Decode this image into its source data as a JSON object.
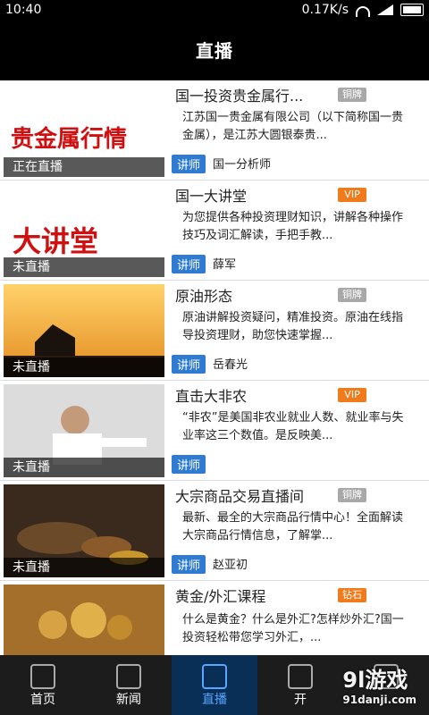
{
  "status": {
    "time": "10:40",
    "speed": "0.17K/s"
  },
  "header": {
    "title": "直播"
  },
  "items": [
    {
      "title": "国一投资贵金属行...",
      "tag": "铜牌",
      "tag_color": "#a8a8a8",
      "desc": "江苏国一贵金属有限公司（以下简称国一贵金属），是江苏大圆银泰贵...",
      "badge": "讲师",
      "lecturer": "国一分析师",
      "live": "正在直播",
      "thumb_color": "#ffffff"
    },
    {
      "title": "国一大讲堂",
      "tag": "VIP",
      "tag_color": "#f07b1d",
      "desc": "为您提供各种投资理财知识，讲解各种操作技巧及词汇解读，手把手教...",
      "badge": "讲师",
      "lecturer": "薛军",
      "live": "未直播",
      "thumb_color": "#ffffff"
    },
    {
      "title": "原油形态",
      "tag": "铜牌",
      "tag_color": "#a8a8a8",
      "desc": "原油讲解投资疑问，精准投资。原油在线指导投资理财，助您快速掌握...",
      "badge": "讲师",
      "lecturer": "岳春光",
      "live": "未直播",
      "thumb_color": "#e39a2b"
    },
    {
      "title": "直击大非农",
      "tag": "VIP",
      "tag_color": "#f07b1d",
      "desc": "“非农”是美国非农业就业人数、就业率与失业率这三个数值。是反映美...",
      "badge": "讲师",
      "lecturer": "",
      "live": "未直播",
      "thumb_color": "#dcdcdc"
    },
    {
      "title": "大宗商品交易直播间",
      "tag": "铜牌",
      "tag_color": "#a8a8a8",
      "desc": "最新、最全的大宗商品行情中心！全面解读大宗商品行情信息，了解掌...",
      "badge": "讲师",
      "lecturer": "赵亚初",
      "live": "未直播",
      "thumb_color": "#3a2a1d"
    },
    {
      "title": "黄金/外汇课程",
      "tag": "钻石",
      "tag_color": "#f07b1d",
      "desc": "什么是黄金？什么是外汇?怎样炒外汇?国一投资轻松带您学习外汇，...",
      "badge": "",
      "lecturer": "",
      "live": "",
      "thumb_color": "#a36f2a"
    }
  ],
  "tabs": [
    {
      "label": "首页",
      "icon": "home-icon"
    },
    {
      "label": "新闻",
      "icon": "news-icon"
    },
    {
      "label": "直播",
      "icon": "live-icon"
    },
    {
      "label": "开",
      "icon": "open-icon"
    },
    {
      "label": "",
      "icon": "more-icon"
    }
  ],
  "watermark": {
    "main": "9l游戏",
    "sub": "91danji.com"
  }
}
